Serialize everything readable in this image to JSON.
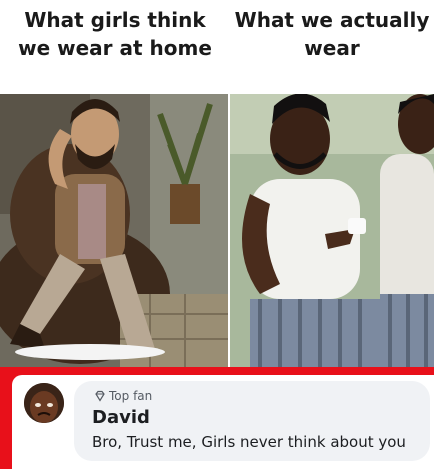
{
  "meme": {
    "left_caption": "What girls think we wear at home",
    "right_caption": "What we actually wear",
    "left_image": "man-lounging-in-patterned-shirt",
    "right_image": "men-in-white-vests-drinking-tea"
  },
  "comment": {
    "badge_icon": "diamond-icon",
    "badge_label": "Top fan",
    "author": "David",
    "text": "Bro, Trust me, Girls never think about you",
    "avatar_icon": "avatar-icon"
  },
  "colors": {
    "accent_red": "#e8101a",
    "bubble_bg": "#f0f2f5"
  }
}
